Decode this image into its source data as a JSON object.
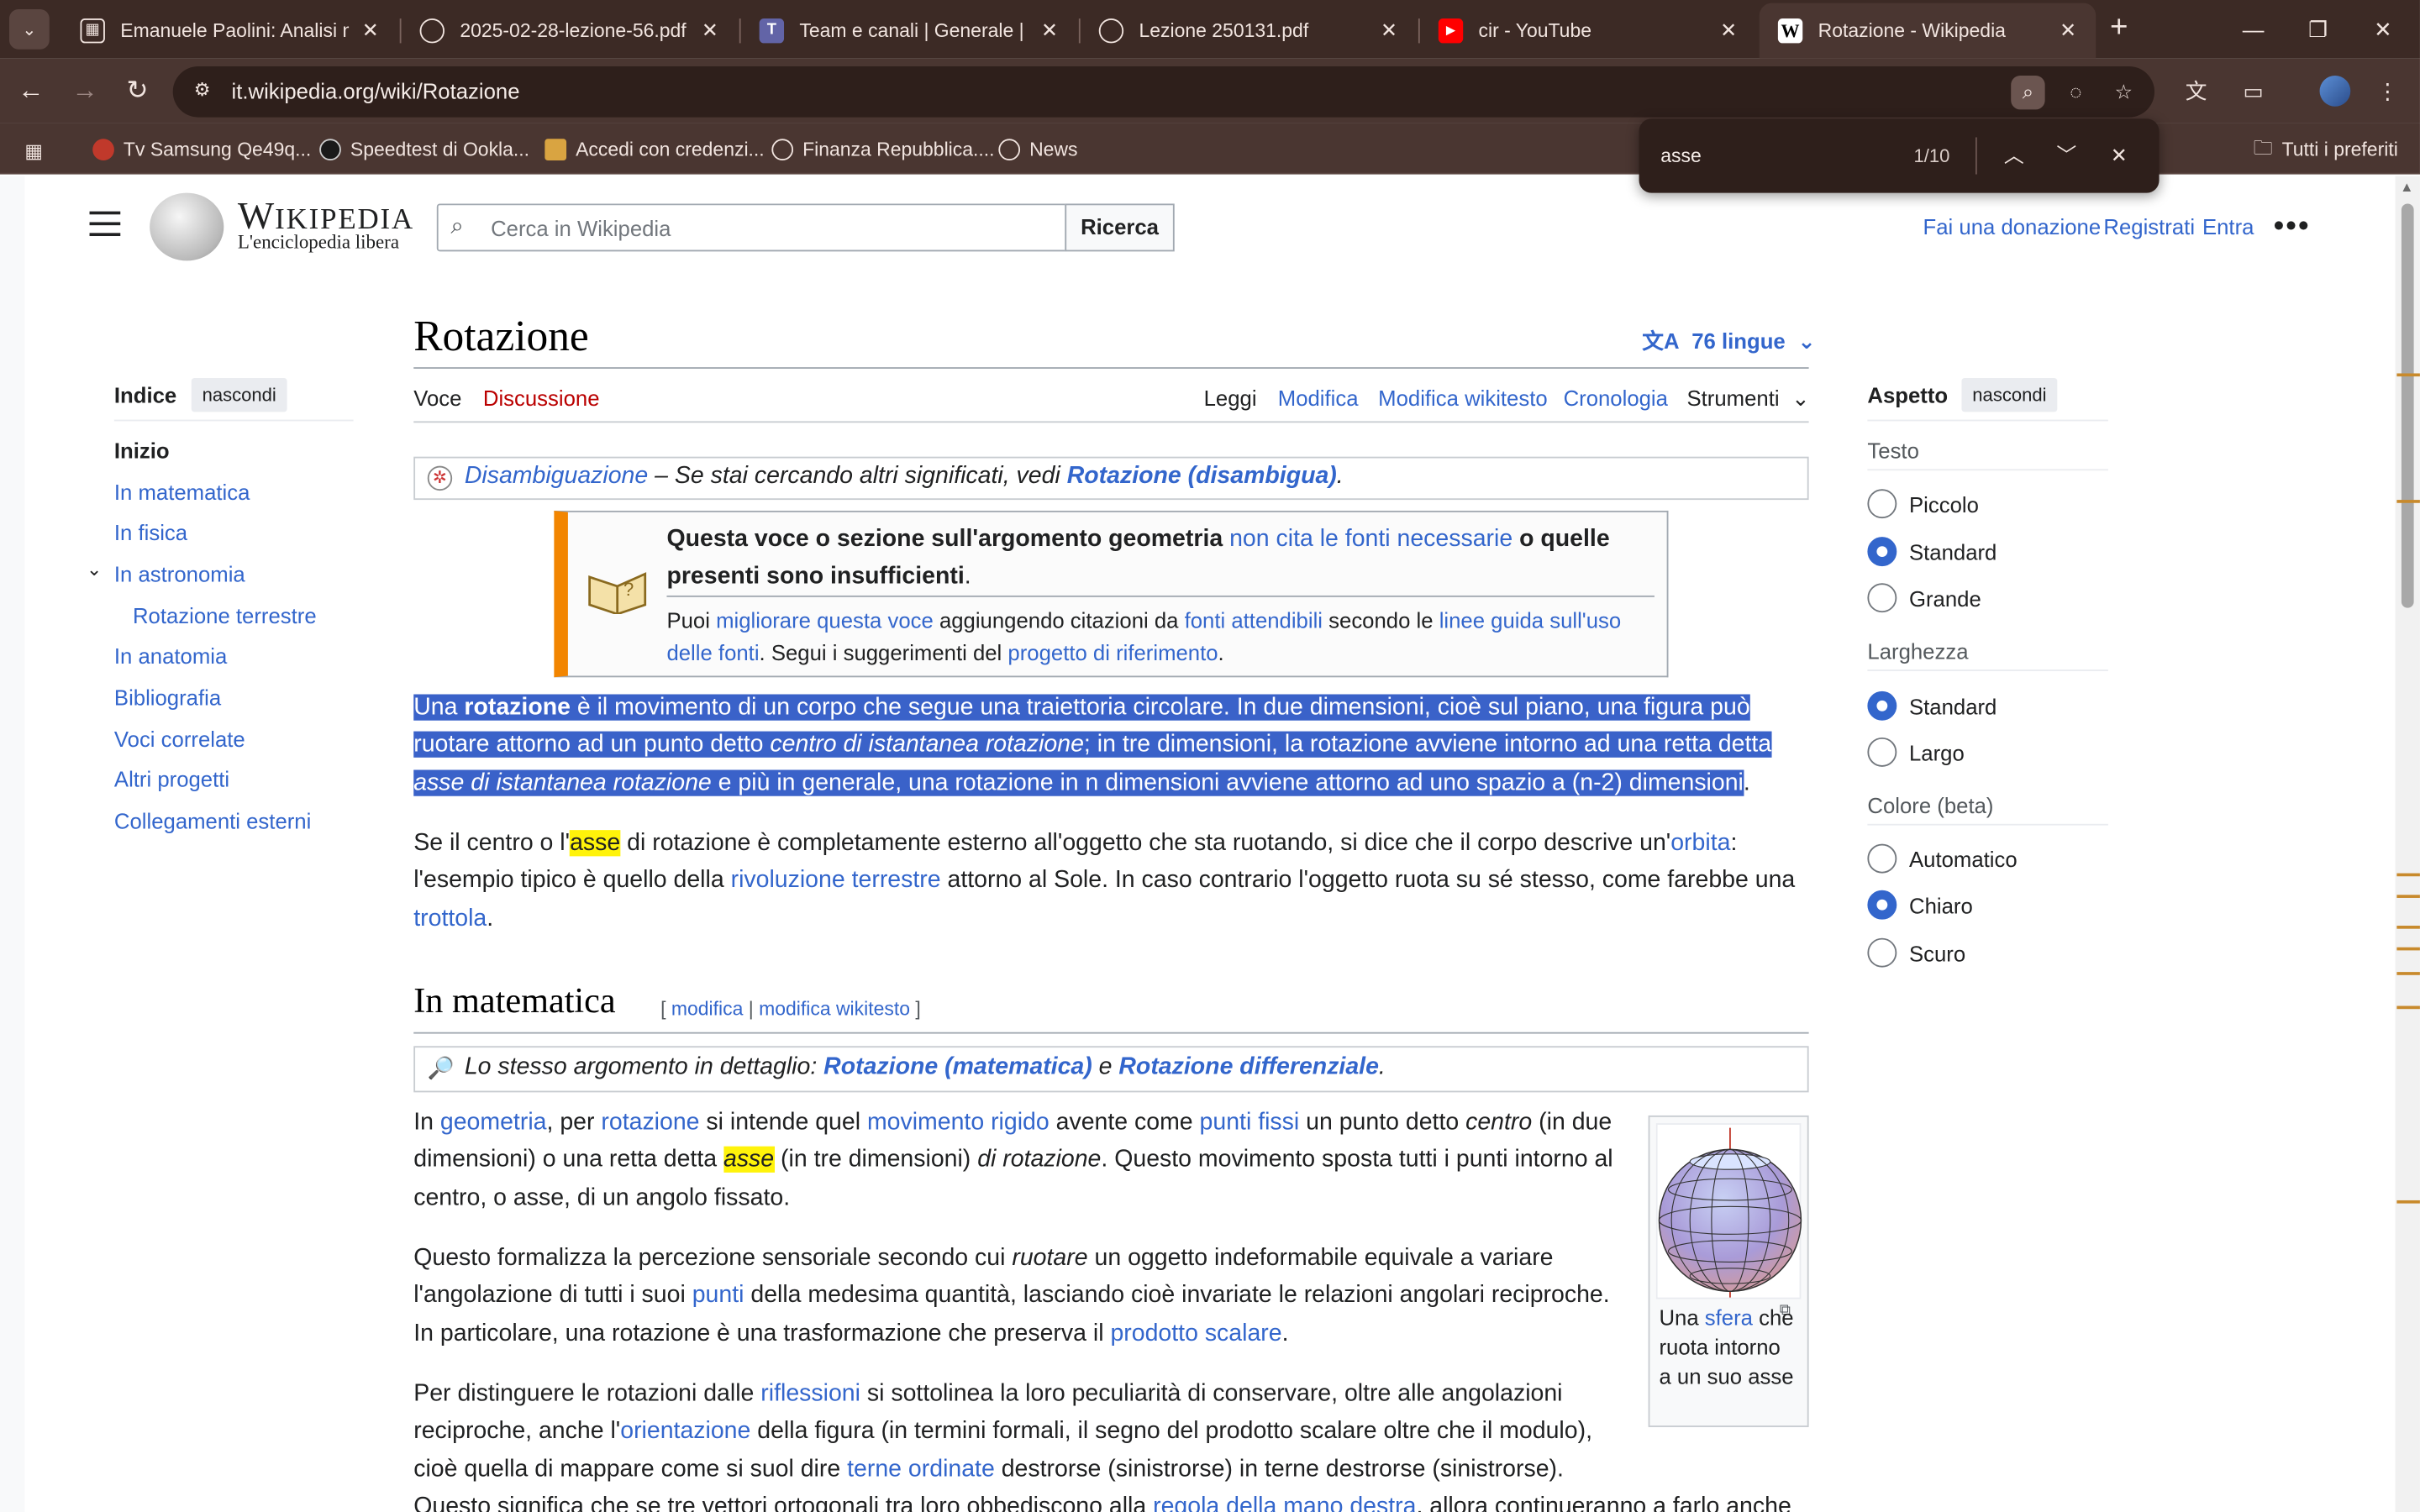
{
  "browser": {
    "tabs": [
      {
        "title": "Emanuele Paolini: Analisi mate",
        "icon": "classroom-icon"
      },
      {
        "title": "2025-02-28-lezione-56.pdf",
        "icon": "globe-icon"
      },
      {
        "title": "Team e canali | Generale | Micr",
        "icon": "teams-icon"
      },
      {
        "title": "Lezione 250131.pdf",
        "icon": "globe-icon"
      },
      {
        "title": "cir - YouTube",
        "icon": "youtube-icon"
      },
      {
        "title": "Rotazione - Wikipedia",
        "icon": "wikipedia-icon"
      }
    ],
    "url": "it.wikipedia.org/wiki/Rotazione",
    "bookmarks": [
      {
        "label": "Tv Samsung Qe49q..."
      },
      {
        "label": "Speedtest di Ookla..."
      },
      {
        "label": "Accedi con credenzi..."
      },
      {
        "label": "Finanza Repubblica...."
      },
      {
        "label": "News"
      }
    ],
    "all_bookmarks": "Tutti i preferiti",
    "find": {
      "query": "asse",
      "count": "1/10"
    },
    "colors": {
      "frame": "#3c2a25",
      "toolbar": "#4a3631",
      "omnibox": "#2e1f1b"
    }
  },
  "wiki": {
    "logo_word": "Wikipedia",
    "logo_tagline": "L'enciclopedia libera",
    "search_placeholder": "Cerca in Wikipedia",
    "search_button": "Ricerca",
    "donate": "Fai una donazione",
    "register": "Registrati",
    "login": "Entra",
    "title": "Rotazione",
    "languages": "76 lingue",
    "tabs": {
      "article": "Voce",
      "talk": "Discussione",
      "read": "Leggi",
      "edit": "Modifica",
      "edit_source": "Modifica wikitesto",
      "history": "Cronologia",
      "tools": "Strumenti"
    },
    "toc": {
      "title": "Indice",
      "hide": "nascondi",
      "items": [
        "Inizio",
        "In matematica",
        "In fisica",
        "In astronomia",
        "Rotazione terrestre",
        "In anatomia",
        "Bibliografia",
        "Voci correlate",
        "Altri progetti",
        "Collegamenti esterni"
      ]
    },
    "hatnote": {
      "link1": "Disambiguazione",
      "text": " – Se stai cercando altri significati, vedi ",
      "link2": "Rotazione (disambigua)",
      "end": "."
    },
    "ambox": {
      "b1": "Questa voce o sezione sull'argomento geometria ",
      "l1": "non cita le fonti necessarie",
      "b2": " o quelle presenti sono insufficienti",
      "b3": ".",
      "s1": "Puoi ",
      "l2": "migliorare questa voce",
      "s2": " aggiungendo citazioni da ",
      "l3": "fonti attendibili",
      "s3": " secondo le ",
      "l4": "linee guida sull'uso delle fonti",
      "s4": ". Segui i suggerimenti del ",
      "l5": "progetto di riferimento",
      "s5": "."
    },
    "intro": {
      "t1": "Una ",
      "b1": "rotazione",
      "t2": " è il movimento di un corpo che segue una traiettoria circolare. In due dimensioni, cioè sul piano, una figura può ruotare attorno ad un punto detto ",
      "i1": "centro di istantanea rotazione",
      "t3": "; in tre dimensioni, la rotazione avviene intorno ad una retta detta ",
      "i2": "asse di istantanea rotazione",
      "t4": " e più in generale, una rotazione in n dimensioni avviene attorno ad uno spazio a (n-2) dimensioni",
      "t5": "."
    },
    "p2": {
      "t1": "Se il centro o l'",
      "hl": "asse",
      "t2": " di rotazione è completamente esterno all'oggetto che sta ruotando, si dice che il corpo descrive un'",
      "l1": "orbita",
      "t3": ": l'esempio tipico è quello della ",
      "l2": "rivoluzione terrestre",
      "t4": " attorno al Sole. In caso contrario l'oggetto ruota su sé stesso, come farebbe una ",
      "l3": "trottola",
      "t5": "."
    },
    "section": {
      "title": "In matematica",
      "edit": "modifica",
      "edit_source": "modifica wikitesto"
    },
    "hatnote2": {
      "text": "Lo stesso argomento in dettaglio: ",
      "l1": "Rotazione (matematica)",
      "and": " e ",
      "l2": "Rotazione differenziale",
      "end": "."
    },
    "p3": {
      "t1": "In ",
      "l1": "geometria",
      "t2": ", per ",
      "l2": "rotazione",
      "t3": " si intende quel ",
      "l3": "movimento rigido",
      "t4": " avente come ",
      "l4": "punti fissi",
      "t5": " un punto detto ",
      "i1": "centro",
      "t6": " (in due dimensioni) o una retta detta ",
      "hl": "asse",
      "t7": " (in tre dimensioni) ",
      "i2": "di rotazione",
      "t8": ". Questo movimento sposta tutti i punti intorno al centro, o asse, di un angolo fissato."
    },
    "p4": {
      "t1": "Questo formalizza la percezione sensoriale secondo cui ",
      "i1": "ruotare",
      "t2": " un oggetto indeformabile equivale a variare l'angolazione di tutti i suoi ",
      "l1": "punti",
      "t3": " della medesima quantità, lasciando cioè invariate le relazioni angolari reciproche. In particolare, una rotazione è una trasformazione che preserva il ",
      "l2": "prodotto scalare",
      "t4": "."
    },
    "p5": {
      "t1": "Per distinguere le rotazioni dalle ",
      "l1": "riflessioni",
      "t2": " si sottolinea la loro peculiarità di conservare, oltre alle angolazioni reciproche, anche l'",
      "l2": "orientazione",
      "t3": " della figura (in termini formali, il segno del prodotto scalare oltre che il modulo), cioè quella di mappare come si suol dire ",
      "l3": "terne ordinate",
      "t4": " destrorse (sinistrorse) in terne destrorse (sinistrorse).",
      "t5": "Questo significa che se tre vettori ortogonali tra loro obbediscono alla ",
      "l4": "regola della mano destra",
      "t6": ", allora continueranno a farlo anche"
    },
    "figure": {
      "c1": "Una ",
      "l1": "sfera",
      "c2": " che ruota intorno a un suo asse"
    },
    "appearance": {
      "title": "Aspetto",
      "hide": "nascondi",
      "text_head": "Testo",
      "text_opts": [
        "Piccolo",
        "Standard",
        "Grande"
      ],
      "text_selected": "Standard",
      "width_head": "Larghezza",
      "width_opts": [
        "Standard",
        "Largo"
      ],
      "width_selected": "Standard",
      "color_head": "Colore (beta)",
      "color_opts": [
        "Automatico",
        "Chiaro",
        "Scuro"
      ],
      "color_selected": "Chiaro"
    }
  }
}
